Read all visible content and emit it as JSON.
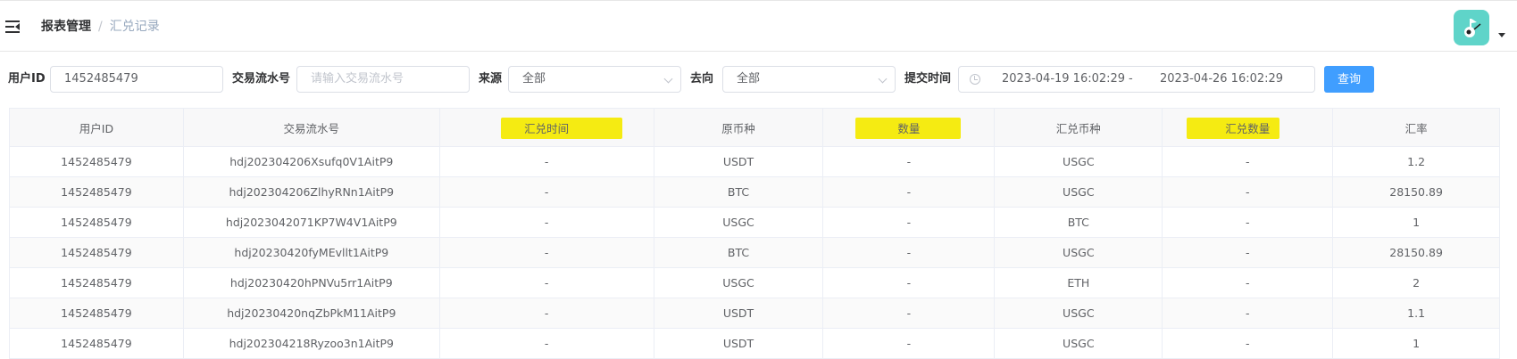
{
  "header": {
    "breadcrumb": [
      "报表管理",
      "汇兑记录"
    ],
    "separator": "/"
  },
  "filters": {
    "user_id_label": "用户ID",
    "user_id_value": "1452485479",
    "serial_label": "交易流水号",
    "serial_placeholder": "请输入交易流水号",
    "source_label": "来源",
    "source_value": "全部",
    "target_label": "去向",
    "target_value": "全部",
    "time_label": "提交时间",
    "time_start": "2023-04-19 16:02:29",
    "time_sep": "-",
    "time_end": "2023-04-26 16:02:29",
    "query_button": "查询"
  },
  "table": {
    "columns": [
      "用户ID",
      "交易流水号",
      "汇兑时间",
      "原币种",
      "数量",
      "汇兑币种",
      "汇兑数量",
      "汇率"
    ],
    "highlighted_columns": [
      "汇兑时间",
      "数量",
      "汇兑数量"
    ],
    "highlight_color": "#f5eb12",
    "rows": [
      [
        "1452485479",
        "hdj202304206Xsufq0V1AitP9",
        "-",
        "USDT",
        "-",
        "USGC",
        "-",
        "1.2"
      ],
      [
        "1452485479",
        "hdj202304206ZlhyRNn1AitP9",
        "-",
        "BTC",
        "-",
        "USGC",
        "-",
        "28150.89"
      ],
      [
        "1452485479",
        "hdj2023042071KP7W4V1AitP9",
        "-",
        "USGC",
        "-",
        "BTC",
        "-",
        "1"
      ],
      [
        "1452485479",
        "hdj20230420fyMEvllt1AitP9",
        "-",
        "BTC",
        "-",
        "USGC",
        "-",
        "28150.89"
      ],
      [
        "1452485479",
        "hdj20230420hPNVu5rr1AitP9",
        "-",
        "USGC",
        "-",
        "ETH",
        "-",
        "2"
      ],
      [
        "1452485479",
        "hdj20230420nqZbPkM11AitP9",
        "-",
        "USDT",
        "-",
        "USGC",
        "-",
        "1.1"
      ],
      [
        "1452485479",
        "hdj202304218Ryzoo3n1AitP9",
        "-",
        "USDT",
        "-",
        "USGC",
        "-",
        "1"
      ]
    ]
  },
  "colors": {
    "primary": "#409eff",
    "avatar_bg": "#5fd4c9"
  },
  "icons": [
    "hamburger-icon",
    "avatar-icon",
    "caret-down-icon",
    "chevron-down-icon",
    "clock-icon"
  ]
}
